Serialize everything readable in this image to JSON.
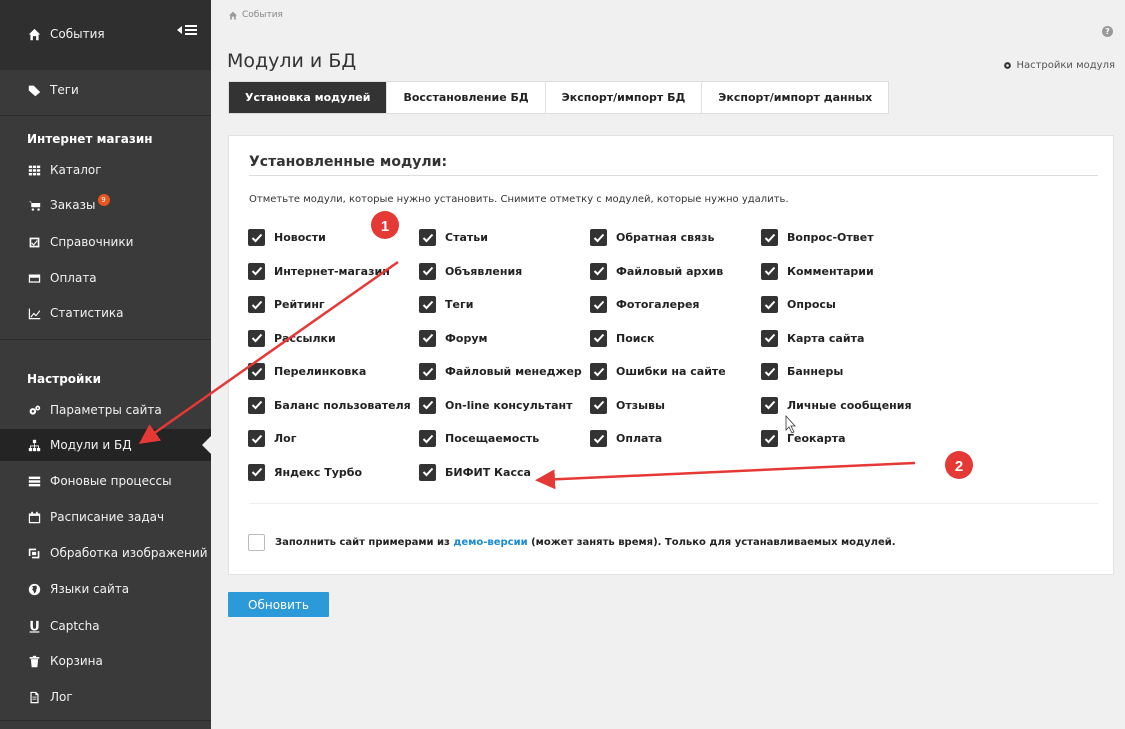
{
  "sidebar": {
    "top_item": "События",
    "items_top": [
      {
        "label": "Теги",
        "icon": "tag-icon"
      }
    ],
    "shop_header": "Интернет магазин",
    "shop_items": [
      {
        "label": "Каталог",
        "icon": "grid-icon"
      },
      {
        "label": "Заказы",
        "icon": "cart-icon",
        "badge": "9"
      },
      {
        "label": "Справочники",
        "icon": "checkbox-icon"
      },
      {
        "label": "Оплата",
        "icon": "card-icon"
      },
      {
        "label": "Статистика",
        "icon": "chart-icon"
      }
    ],
    "settings_header": "Настройки",
    "settings_items": [
      {
        "label": "Параметры сайта",
        "icon": "gears-icon"
      },
      {
        "label": "Модули и БД",
        "icon": "sitemap-icon",
        "active": true
      },
      {
        "label": "Фоновые процессы",
        "icon": "tasks-icon"
      },
      {
        "label": "Расписание задач",
        "icon": "calendar-icon"
      },
      {
        "label": "Обработка изображений",
        "icon": "crop-icon"
      },
      {
        "label": "Языки сайта",
        "icon": "globe-icon"
      },
      {
        "label": "Captcha",
        "icon": "underline-icon"
      },
      {
        "label": "Корзина",
        "icon": "trash-icon"
      },
      {
        "label": "Лог",
        "icon": "file-icon"
      }
    ]
  },
  "main": {
    "breadcrumb": "События",
    "title": "Модули и БД",
    "module_settings": "Настройки модуля",
    "tabs": [
      {
        "label": "Установка модулей",
        "active": true
      },
      {
        "label": "Восстановление БД"
      },
      {
        "label": "Экспорт/импорт БД"
      },
      {
        "label": "Экспорт/импорт данных"
      }
    ],
    "panel_title": "Установленные модули:",
    "panel_hint": "Отметьте модули, которые нужно установить. Снимите отметку с модулей, которые нужно удалить.",
    "modules": [
      [
        "Новости",
        "Статьи",
        "Обратная связь",
        "Вопрос-Ответ"
      ],
      [
        "Интернет-магазин",
        "Объявления",
        "Файловый архив",
        "Комментарии"
      ],
      [
        "Рейтинг",
        "Теги",
        "Фотогалерея",
        "Опросы"
      ],
      [
        "Рассылки",
        "Форум",
        "Поиск",
        "Карта сайта"
      ],
      [
        "Перелинковка",
        "Файловый менеджер",
        "Ошибки на сайте",
        "Баннеры"
      ],
      [
        "Баланс пользователя",
        "On-line консультант",
        "Отзывы",
        "Личные сообщения"
      ],
      [
        "Лог",
        "Посещаемость",
        "Оплата",
        "Геокарта"
      ],
      [
        "Яндекс Турбо",
        "БИФИТ Касса"
      ]
    ],
    "demo_prefix": "Заполнить сайт примерами из ",
    "demo_link": "демо-версии",
    "demo_suffix": " (может занять время). Только для устанавливаемых модулей.",
    "update_button": "Обновить"
  },
  "annotations": [
    {
      "number": "1"
    },
    {
      "number": "2"
    }
  ],
  "colors": {
    "sidebar_bg": "#3a3a3a",
    "accent_blue": "#2c9ad9",
    "annotation_red": "#e53935"
  }
}
